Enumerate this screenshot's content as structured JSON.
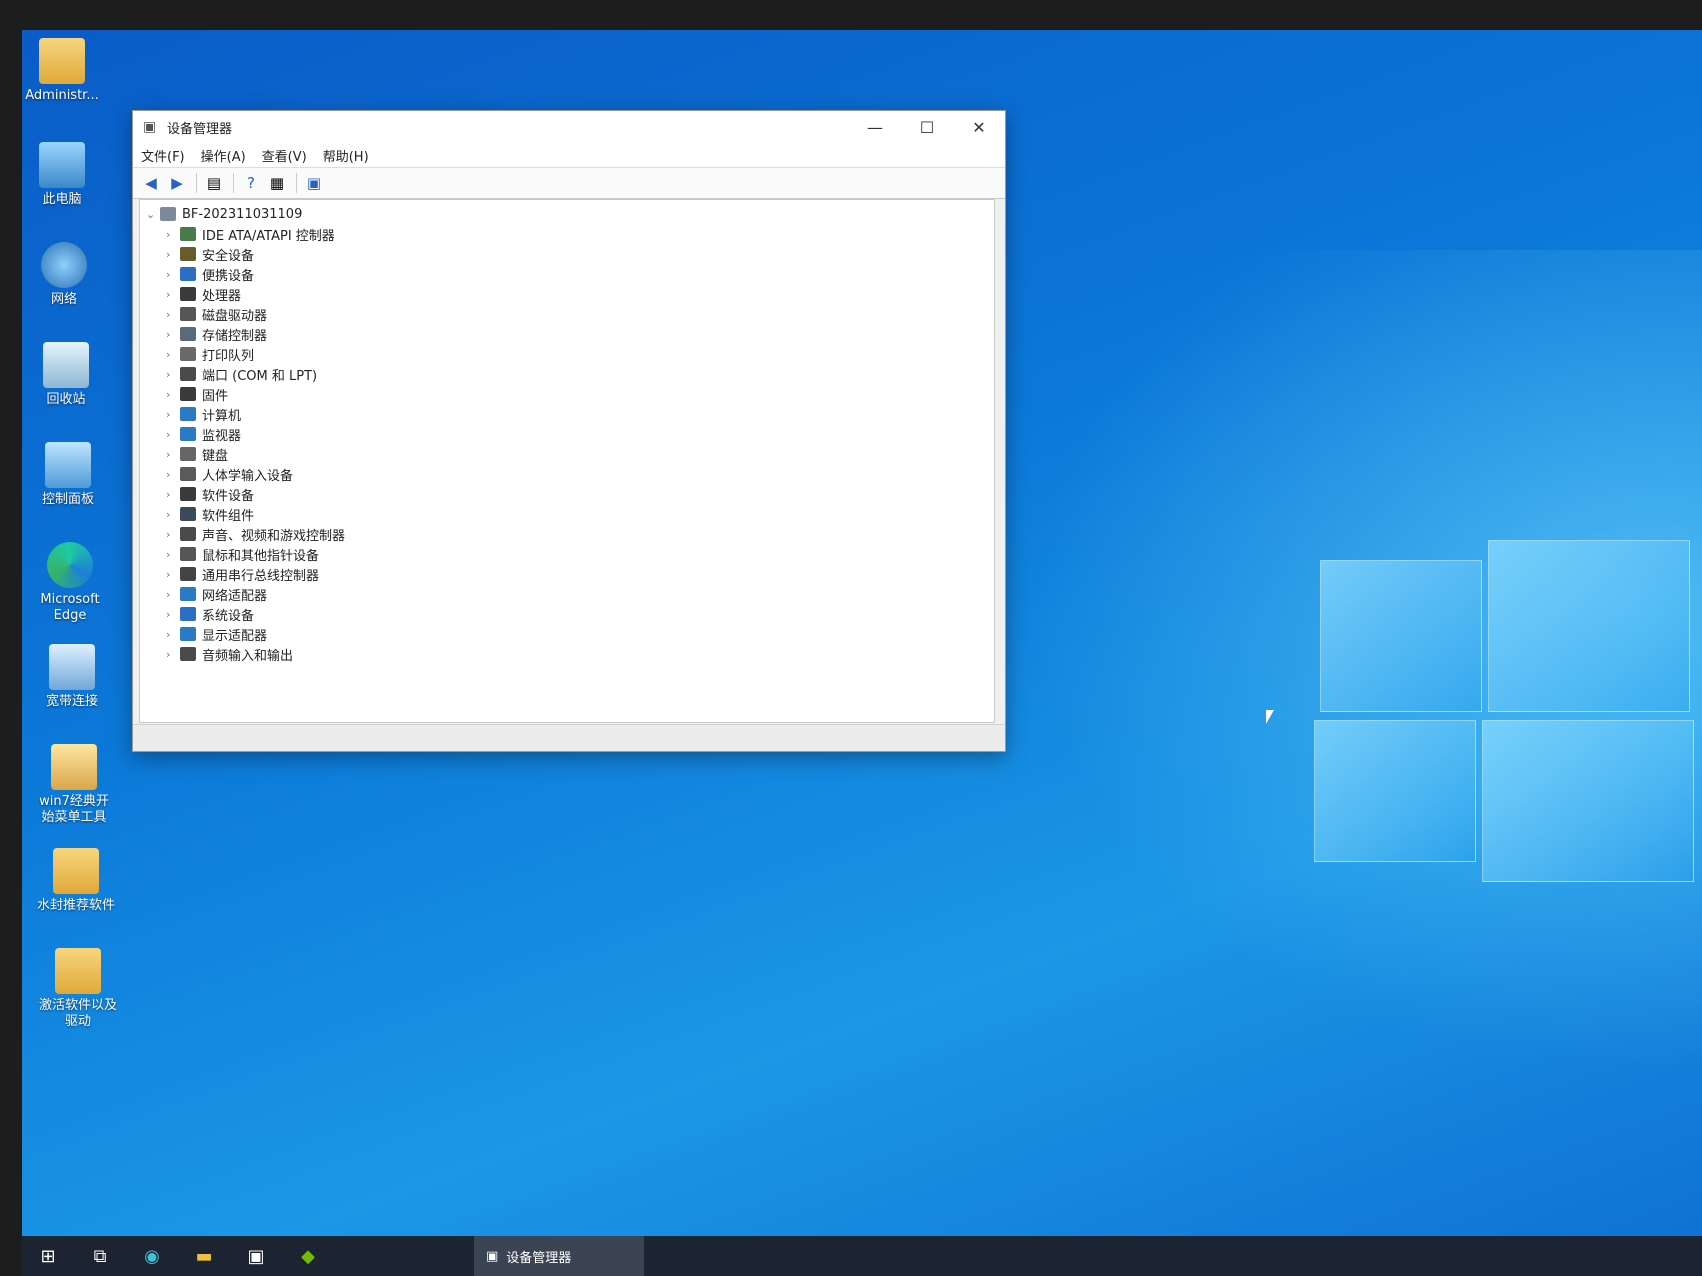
{
  "desktop": {
    "icons": [
      {
        "label": "Administr...",
        "icon": "user-folder-icon"
      },
      {
        "label": "此电脑",
        "icon": "computer-icon"
      },
      {
        "label": "网络",
        "icon": "network-icon"
      },
      {
        "label": "回收站",
        "icon": "recycle-bin-icon"
      },
      {
        "label": "控制面板",
        "icon": "control-panel-icon"
      },
      {
        "label": "Microsoft Edge",
        "icon": "edge-icon"
      },
      {
        "label": "宽带连接",
        "icon": "broadband-icon"
      },
      {
        "label": "win7经典开始菜单工具",
        "icon": "document-icon"
      },
      {
        "label": "水封推荐软件",
        "icon": "folder-icon"
      },
      {
        "label": "激活软件以及驱动",
        "icon": "folder-icon"
      }
    ]
  },
  "window": {
    "title": "设备管理器",
    "controls": {
      "minimize": "—",
      "maximize": "☐",
      "close": "✕"
    },
    "menu": [
      "文件(F)",
      "操作(A)",
      "查看(V)",
      "帮助(H)"
    ],
    "toolbar": [
      "back-icon",
      "forward-icon",
      "properties-icon",
      "help-icon",
      "view-icon",
      "scan-hardware-icon"
    ],
    "tree": {
      "root": "BF-202311031109",
      "nodes": [
        {
          "label": "IDE ATA/ATAPI 控制器",
          "color": "#4a7a4a"
        },
        {
          "label": "安全设备",
          "color": "#6b5a2a"
        },
        {
          "label": "便携设备",
          "color": "#2a6fc4"
        },
        {
          "label": "处理器",
          "color": "#3a3a3a"
        },
        {
          "label": "磁盘驱动器",
          "color": "#555555"
        },
        {
          "label": "存储控制器",
          "color": "#5a6a7a"
        },
        {
          "label": "打印队列",
          "color": "#6a6a6a"
        },
        {
          "label": "端口 (COM 和 LPT)",
          "color": "#4a4a4a"
        },
        {
          "label": "固件",
          "color": "#3a3a3a"
        },
        {
          "label": "计算机",
          "color": "#2a7ac4"
        },
        {
          "label": "监视器",
          "color": "#2a7ac4"
        },
        {
          "label": "键盘",
          "color": "#666666"
        },
        {
          "label": "人体学输入设备",
          "color": "#5a5a5a"
        },
        {
          "label": "软件设备",
          "color": "#3a3a3a"
        },
        {
          "label": "软件组件",
          "color": "#3a4a5a"
        },
        {
          "label": "声音、视频和游戏控制器",
          "color": "#4a4a4a"
        },
        {
          "label": "鼠标和其他指针设备",
          "color": "#555555"
        },
        {
          "label": "通用串行总线控制器",
          "color": "#444444"
        },
        {
          "label": "网络适配器",
          "color": "#2a7ac4"
        },
        {
          "label": "系统设备",
          "color": "#2a6fc4"
        },
        {
          "label": "显示适配器",
          "color": "#2a7ac4"
        },
        {
          "label": "音频输入和输出",
          "color": "#4a4a4a"
        }
      ]
    }
  },
  "taskbar": {
    "items": [
      "start-icon",
      "task-view-icon",
      "edge-icon",
      "file-explorer-icon",
      "store-icon",
      "nvidia-icon"
    ],
    "active_app": "设备管理器"
  }
}
